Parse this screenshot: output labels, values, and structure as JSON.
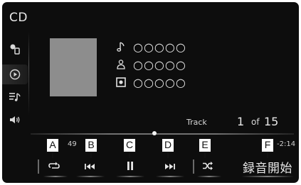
{
  "screen": {
    "title": "CD"
  },
  "sidebar": {
    "items": [
      {
        "icon": "source-device-icon",
        "active": false
      },
      {
        "icon": "play-circle-icon",
        "active": true
      },
      {
        "icon": "playlist-music-icon",
        "active": false
      },
      {
        "icon": "speaker-volume-icon",
        "active": false
      }
    ]
  },
  "now_playing": {
    "song": "○○○○○",
    "artist": "○○○○○",
    "album": "○○○○○",
    "track_label": "Track",
    "track_current": "1",
    "track_of": "of",
    "track_total": "15",
    "time_elapsed": "49",
    "time_remaining": "-2:14",
    "progress_fraction": 0.47
  },
  "controls": {
    "repeat_icon": "repeat-icon",
    "prev_icon": "previous-track-icon",
    "pause_icon": "pause-icon",
    "next_icon": "next-track-icon",
    "shuffle_icon": "shuffle-icon",
    "record_label": "録音開始"
  },
  "callouts": {
    "a": "A",
    "b": "B",
    "c": "C",
    "d": "D",
    "e": "E",
    "f": "F"
  },
  "colors": {
    "screen_bg": "#0d0d0d",
    "art_placeholder": "#8d8d8d",
    "text": "#e8e8e8",
    "callout_border": "#111111"
  }
}
